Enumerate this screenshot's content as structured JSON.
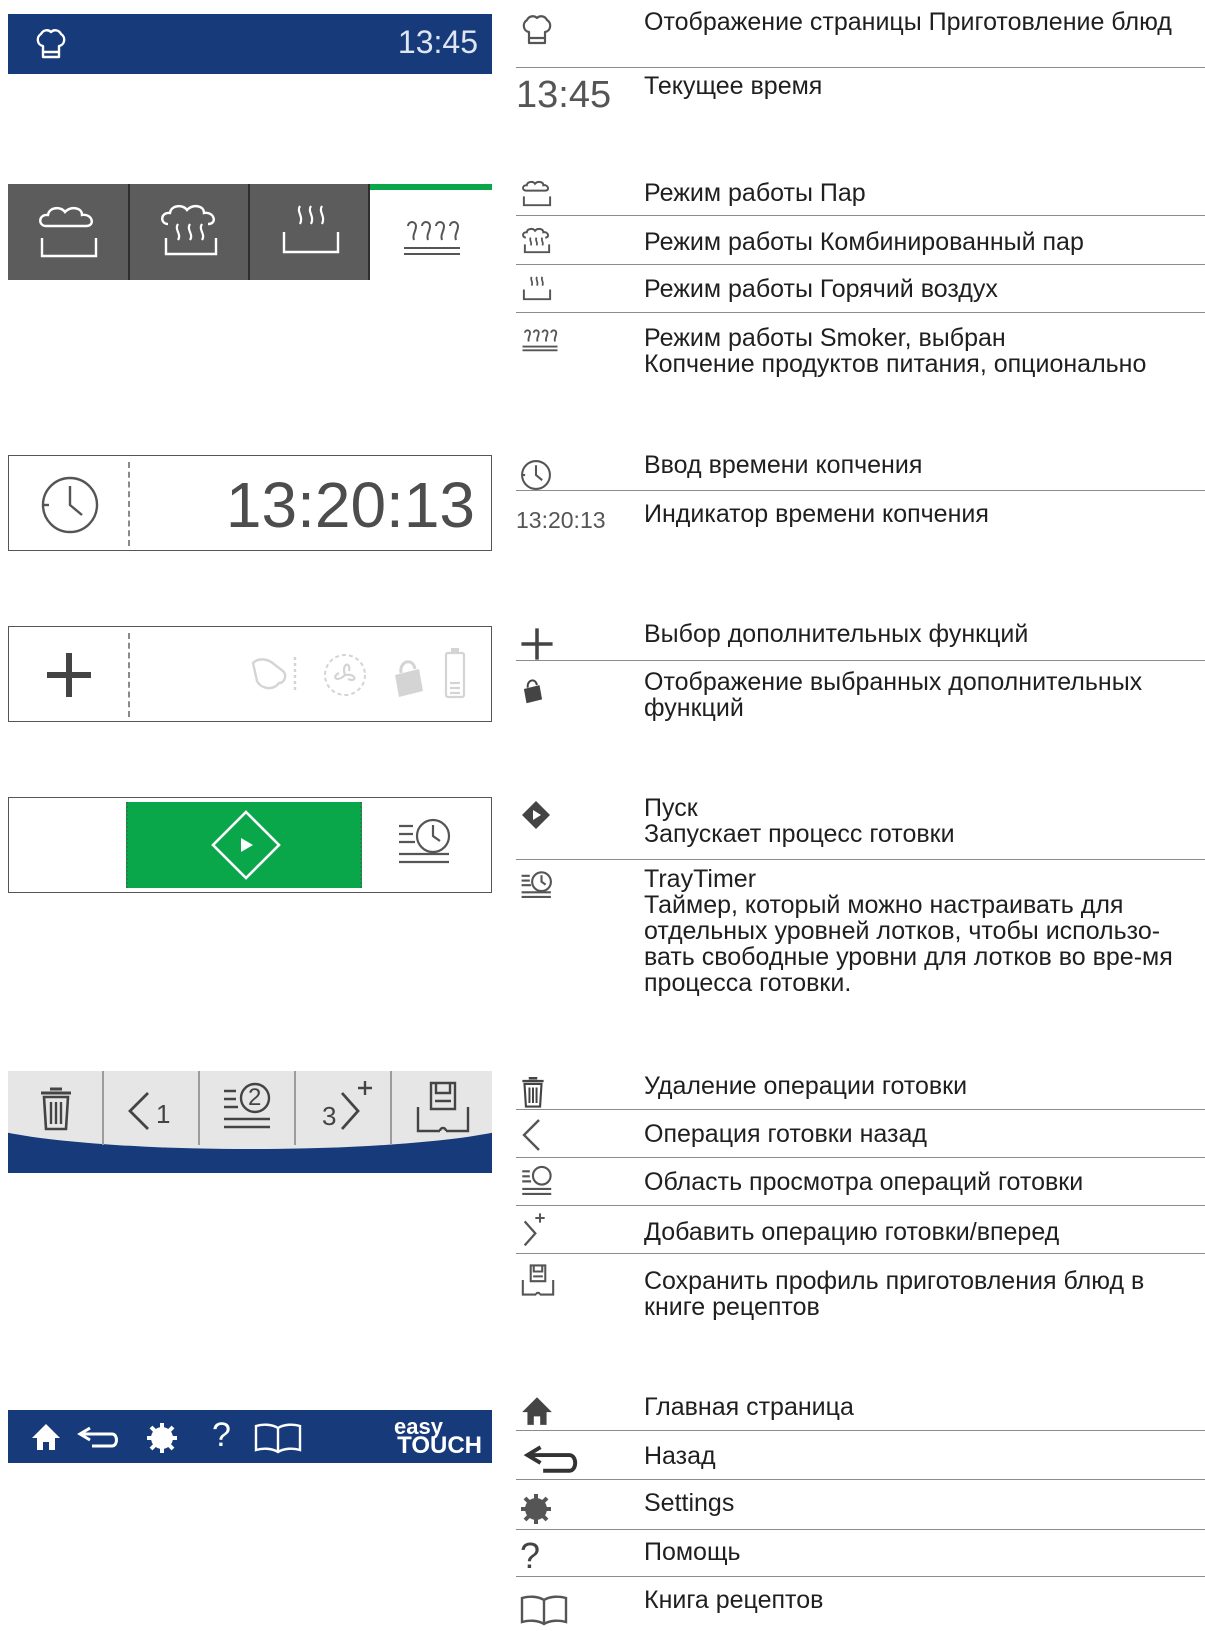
{
  "top_bar": {
    "time": "13:45"
  },
  "smoke_panel": {
    "time": "13:20:13"
  },
  "footer_bar": {
    "brand_top": "easy",
    "brand_bottom": "TOUCH",
    "help_glyph": "?"
  },
  "step_bar": {
    "prev_label": "1",
    "view_label": "2",
    "next_label": "3"
  },
  "legend": {
    "cooking_page": "Отображение страницы Приготовление блюд",
    "time_symbol": "13:45",
    "current_time": "Текущее время",
    "steam": "Режим работы Пар",
    "combi_steam": "Режим работы Комбинированный пар",
    "hot_air": "Режим работы Горячий воздух",
    "smoker": "Режим работы Smoker, выбран\nКопчение продуктов питания, опционально",
    "smoke_time_input": "Ввод времени копчения",
    "smoke_time_symbol": "13:20:13",
    "smoke_time_indicator": "Индикатор времени копчения",
    "extra_functions_select": "Выбор дополнительных функций",
    "extra_functions_show": "Отображение выбранных дополнительных функций",
    "start": "Пуск\nЗапускает процесс готовки",
    "traytimer": "TrayTimer\nТаймер, который можно настраивать для отдельных уровней лотков, чтобы использо-вать свободные уровни для лотков во вре-мя процесса готовки.",
    "delete_step": "Удаление операции готовки",
    "step_back": "Операция готовки назад",
    "step_view": "Область просмотра операций готовки",
    "step_add": "Добавить операцию готовки/вперед",
    "save_profile": "Сохранить профиль приготовления блюд в книге рецептов",
    "home": "Главная страница",
    "back": "Назад",
    "settings": "Settings",
    "help_glyph": "?",
    "help": "Помощь",
    "recipes": "Книга рецептов"
  },
  "colors": {
    "navy": "#173a7a",
    "green": "#0aa64a",
    "dark_tile": "#5c5c5c"
  }
}
